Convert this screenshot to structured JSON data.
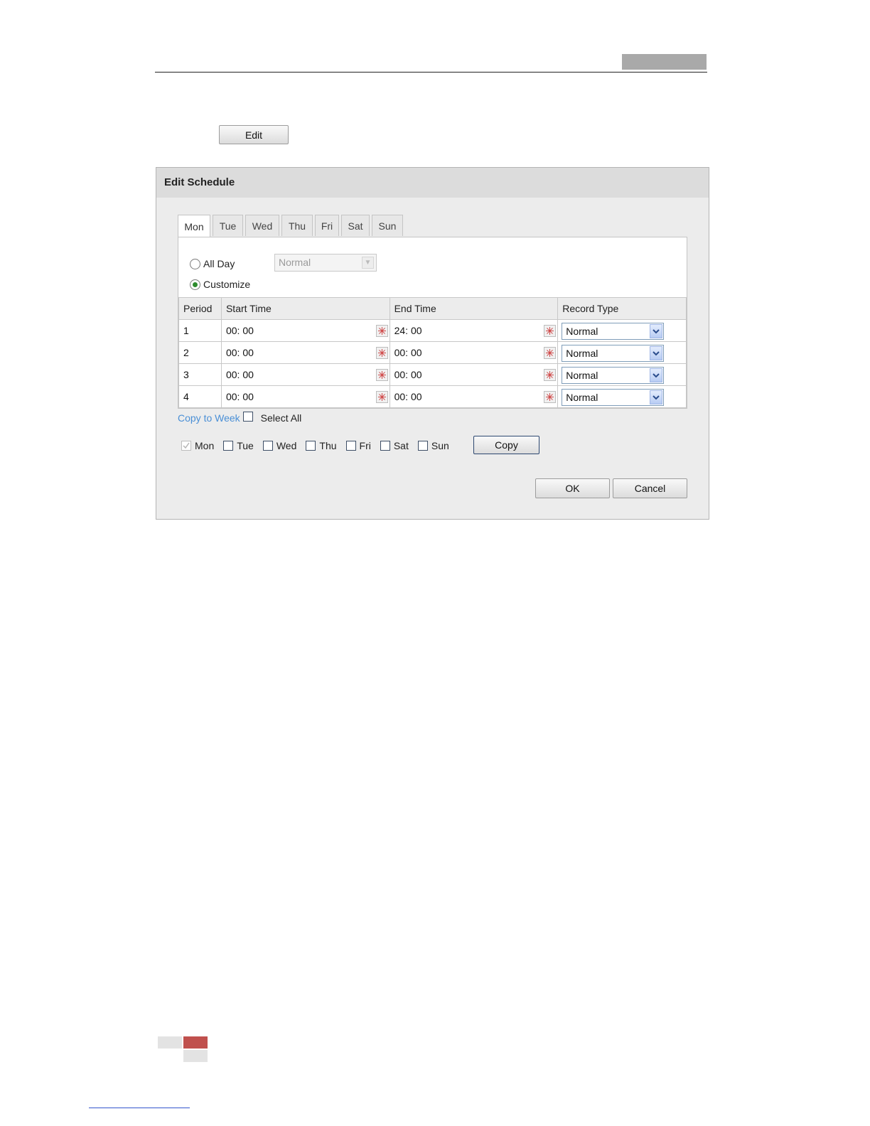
{
  "edit_button": "Edit",
  "dialog": {
    "title": "Edit Schedule",
    "tabs": [
      "Mon",
      "Tue",
      "Wed",
      "Thu",
      "Fri",
      "Sat",
      "Sun"
    ],
    "active_tab": "Mon",
    "all_day_label": "All Day",
    "all_day_type": "Normal",
    "customize_label": "Customize",
    "selected_mode": "Customize",
    "columns": [
      "Period",
      "Start Time",
      "End Time",
      "Record Type"
    ],
    "rows": [
      {
        "period": "1",
        "start": "00: 00",
        "end": "24: 00",
        "record_type": "Normal"
      },
      {
        "period": "2",
        "start": "00: 00",
        "end": "00: 00",
        "record_type": "Normal"
      },
      {
        "period": "3",
        "start": "00: 00",
        "end": "00: 00",
        "record_type": "Normal"
      },
      {
        "period": "4",
        "start": "00: 00",
        "end": "00: 00",
        "record_type": "Normal"
      }
    ],
    "copy_to_week_label": "Copy to Week",
    "select_all_label": "Select All",
    "copy_days": [
      {
        "label": "Mon",
        "checked": true
      },
      {
        "label": "Tue",
        "checked": false
      },
      {
        "label": "Wed",
        "checked": false
      },
      {
        "label": "Thu",
        "checked": false
      },
      {
        "label": "Fri",
        "checked": false
      },
      {
        "label": "Sat",
        "checked": false
      },
      {
        "label": "Sun",
        "checked": false
      }
    ],
    "copy_button": "Copy",
    "ok_button": "OK",
    "cancel_button": "Cancel"
  },
  "colors": {
    "accent_link": "#4a8fd6",
    "footer_red": "#c0504d"
  }
}
